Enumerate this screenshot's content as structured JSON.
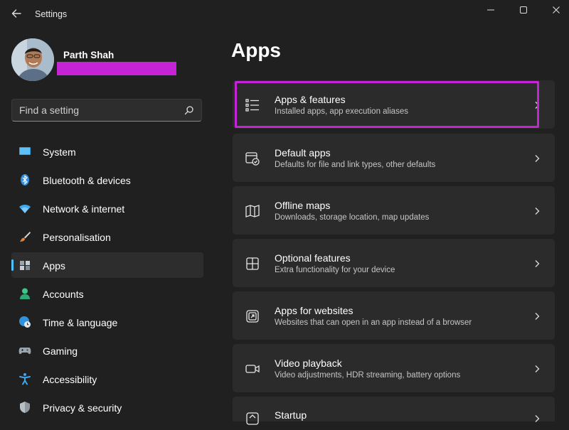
{
  "window": {
    "title": "Settings"
  },
  "profile": {
    "name": "Parth Shah"
  },
  "search": {
    "placeholder": "Find a setting"
  },
  "nav": {
    "items": [
      {
        "label": "System",
        "icon": "monitor-icon",
        "selected": false
      },
      {
        "label": "Bluetooth & devices",
        "icon": "bluetooth-icon",
        "selected": false
      },
      {
        "label": "Network & internet",
        "icon": "wifi-icon",
        "selected": false
      },
      {
        "label": "Personalisation",
        "icon": "paintbrush-icon",
        "selected": false
      },
      {
        "label": "Apps",
        "icon": "apps-icon",
        "selected": true
      },
      {
        "label": "Accounts",
        "icon": "person-icon",
        "selected": false
      },
      {
        "label": "Time & language",
        "icon": "globe-clock-icon",
        "selected": false
      },
      {
        "label": "Gaming",
        "icon": "gamepad-icon",
        "selected": false
      },
      {
        "label": "Accessibility",
        "icon": "accessibility-icon",
        "selected": false
      },
      {
        "label": "Privacy & security",
        "icon": "shield-icon",
        "selected": false
      }
    ]
  },
  "main": {
    "title": "Apps",
    "cards": [
      {
        "title": "Apps & features",
        "subtitle": "Installed apps, app execution aliases",
        "icon": "list-icon",
        "highlighted": true
      },
      {
        "title": "Default apps",
        "subtitle": "Defaults for file and link types, other defaults",
        "icon": "default-apps-icon"
      },
      {
        "title": "Offline maps",
        "subtitle": "Downloads, storage location, map updates",
        "icon": "map-icon"
      },
      {
        "title": "Optional features",
        "subtitle": "Extra functionality for your device",
        "icon": "add-grid-icon"
      },
      {
        "title": "Apps for websites",
        "subtitle": "Websites that can open in an app instead of a browser",
        "icon": "open-in-app-icon"
      },
      {
        "title": "Video playback",
        "subtitle": "Video adjustments, HDR streaming, battery options",
        "icon": "video-icon"
      },
      {
        "title": "Startup",
        "subtitle": "",
        "icon": "startup-icon"
      }
    ]
  },
  "colors": {
    "background": "#202020",
    "card": "#2b2b2b",
    "accent": "#4cc2ff",
    "highlight": "#c424d6"
  }
}
